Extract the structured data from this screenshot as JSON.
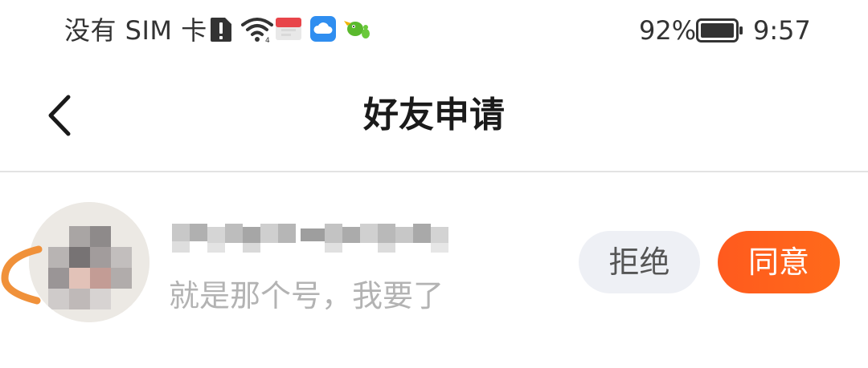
{
  "status_bar": {
    "carrier": "没有 SIM 卡",
    "battery_percent": "92%",
    "battery_level": 0.92,
    "time": "9:57",
    "icons": [
      "alert-icon",
      "wifi-icon",
      "app-notification-red-icon",
      "cloud-app-icon",
      "bird-app-icon",
      "battery-icon"
    ]
  },
  "nav": {
    "title": "好友申请",
    "back_icon": "chevron-left-icon"
  },
  "request": {
    "nickname": "",
    "message": "就是那个号，我要了",
    "reject_label": "拒绝",
    "accept_label": "同意"
  },
  "colors": {
    "accent": "#ff5a1e",
    "reject_bg": "#eef0f5",
    "message_gray": "#b3b3b3",
    "title": "#1a1a1a"
  }
}
